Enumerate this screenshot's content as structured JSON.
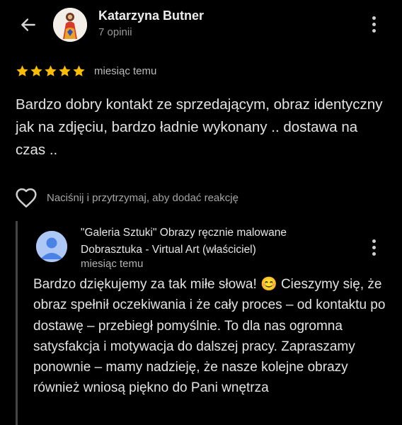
{
  "review": {
    "author_name": "Katarzyna Butner",
    "author_review_count": "7 opinii",
    "rating": 5,
    "rating_max": 5,
    "date": "miesiąc temu",
    "text": "Bardzo dobry kontakt ze sprzedającym, obraz identyczny jak na zdjęciu, bardzo ładnie wykonany .. dostawa na czas .."
  },
  "reaction": {
    "hint": "Naciśnij i przytrzymaj, aby dodać reakcję"
  },
  "owner_reply": {
    "owner_name": "\"Galeria Sztuki\" Obrazy ręcznie malowane Dobrasztuka - Virtual Art (właściciel)",
    "date": "miesiąc temu",
    "text": "Bardzo dziękujemy za tak miłe słowa! 😊 Cieszymy się, że obraz spełnił oczekiwania i że cały proces – od kontaktu po dostawę – przebiegł pomyślnie. To dla nas ogromna satysfakcja i motywacja do dalszej pracy. Zapraszamy ponownie – mamy nadzieję, że nasze kolejne obrazy również wniosą piękno do Pani wnętrza"
  },
  "colors": {
    "background": "#000000",
    "star": "#fbbc04",
    "text": "#e3e3e3",
    "secondary_text": "#9a9a9a",
    "owner_avatar": "#aec8f5"
  }
}
